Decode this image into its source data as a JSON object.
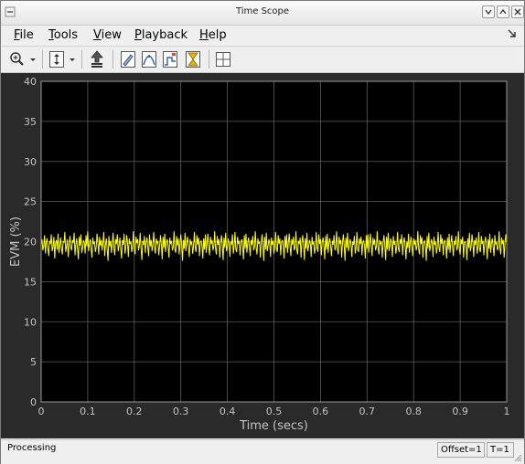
{
  "window": {
    "title": "Time Scope"
  },
  "menu": [
    {
      "label": "File",
      "mnemonic": "F",
      "rest": "ile"
    },
    {
      "label": "Tools",
      "mnemonic": "T",
      "rest": "ools"
    },
    {
      "label": "View",
      "mnemonic": "V",
      "rest": "iew"
    },
    {
      "label": "Playback",
      "mnemonic": "P",
      "rest": "layback"
    },
    {
      "label": "Help",
      "mnemonic": "H",
      "rest": "elp"
    }
  ],
  "toolbar": {
    "tools": [
      {
        "name": "zoom-in-icon"
      },
      {
        "name": "zoom-dropdown-icon"
      },
      {
        "name": "scale-axes-icon"
      },
      {
        "name": "scale-dropdown-icon"
      },
      {
        "name": "bring-forward-icon"
      },
      {
        "name": "style-icon"
      },
      {
        "name": "measure-peaks-icon"
      },
      {
        "name": "measure-stats-icon"
      },
      {
        "name": "triggers-icon"
      },
      {
        "name": "layout-icon"
      }
    ]
  },
  "colors": {
    "axes_bg": "#000000",
    "figure_bg": "#2a2a2a",
    "grid": "#5e5e5e",
    "tick_text": "#c4c4c4",
    "trace": "#ffff00"
  },
  "chart_data": {
    "type": "line",
    "title": "",
    "xlabel": "Time (secs)",
    "ylabel": "EVM (%)",
    "xlim": [
      0,
      1
    ],
    "ylim": [
      0,
      40
    ],
    "xticks": [
      0,
      0.1,
      0.2,
      0.3,
      0.4,
      0.5,
      0.6,
      0.7,
      0.8,
      0.9,
      1
    ],
    "yticks": [
      0,
      5,
      10,
      15,
      20,
      25,
      30,
      35,
      40
    ],
    "grid": true,
    "legend": "none",
    "series": [
      {
        "color": "#ffff00",
        "x_start": 0,
        "x_end": 1,
        "mean": 19.6,
        "min": 17.5,
        "max": 21.3,
        "samples": [
          19.6,
          20.3,
          18.9,
          19.4,
          20.8,
          18.5,
          19.9,
          20.4,
          19.1,
          18.2,
          20.1,
          19.7,
          20.9,
          18.8,
          19.3,
          20.6,
          17.9,
          19.8,
          20.2,
          19.0,
          21.0,
          18.6,
          19.5,
          20.5,
          19.2,
          18.4,
          20.0,
          19.9,
          21.2,
          18.7,
          19.4,
          20.3,
          18.1,
          19.6,
          20.7,
          19.3,
          18.9,
          20.2,
          19.8,
          21.1,
          18.3,
          19.7,
          20.4,
          19.0,
          17.8,
          20.6,
          19.5,
          20.9,
          18.6,
          19.2,
          20.1,
          19.9,
          18.5,
          20.8,
          19.4,
          21.3,
          18.8,
          19.6,
          20.3,
          19.1,
          18.0,
          20.5,
          19.7,
          20.0,
          18.7,
          19.3,
          21.0,
          19.8,
          18.4,
          20.6,
          19.5,
          20.2,
          18.9,
          19.9,
          21.2,
          18.2,
          19.6,
          20.4,
          19.0,
          17.6,
          20.7,
          19.4,
          20.1,
          18.6,
          19.8,
          21.1,
          19.2,
          18.3,
          20.3,
          19.7,
          20.9,
          18.8,
          19.5,
          20.5,
          19.1,
          17.9,
          20.2,
          19.6,
          21.0,
          18.5,
          19.3,
          20.8,
          19.9,
          18.1,
          20.4,
          19.7,
          20.0,
          18.7,
          19.4,
          21.3,
          19.0,
          18.4,
          20.6,
          19.8,
          20.3,
          18.9,
          19.5,
          21.1,
          19.2,
          17.7,
          20.1,
          19.6,
          20.7,
          18.6,
          19.9,
          20.5,
          19.3,
          18.2,
          20.9,
          19.4,
          20.2,
          18.8,
          19.7,
          21.2,
          19.1,
          18.5,
          20.4,
          19.8,
          20.0,
          18.3,
          19.5,
          20.8,
          19.6,
          17.8,
          20.6,
          19.2,
          21.0,
          18.7,
          19.9,
          20.3,
          19.4,
          18.0,
          20.5,
          19.7,
          20.1,
          18.9,
          19.3,
          21.3,
          19.0,
          18.6,
          20.7,
          19.5,
          20.4,
          18.4,
          19.8,
          20.9,
          19.6,
          17.6,
          20.2,
          19.1,
          21.1,
          18.8,
          19.9,
          20.6,
          19.3,
          18.1,
          20.3,
          19.7,
          20.0,
          18.5,
          19.4,
          21.2,
          19.2,
          18.7,
          20.8,
          19.6,
          20.5,
          18.2,
          19.9,
          20.1,
          19.5,
          17.9,
          20.4,
          19.0,
          20.9,
          18.6,
          19.8,
          21.0,
          19.3,
          18.3,
          20.6,
          19.7,
          20.2,
          18.9,
          19.4,
          21.3,
          19.1,
          18.4,
          20.7,
          19.6,
          20.3,
          18.0,
          19.9,
          20.8,
          19.5,
          17.7,
          20.5,
          19.2,
          21.1,
          18.8,
          19.3,
          20.4,
          19.8,
          18.1,
          20.0,
          19.6,
          20.9,
          18.5,
          19.4,
          21.2,
          19.0,
          18.7,
          20.6,
          19.7,
          20.1,
          18.3,
          19.9,
          20.3,
          19.5,
          17.8,
          20.8,
          19.1,
          21.0,
          18.6,
          19.8,
          20.5,
          19.4,
          18.2,
          20.2,
          19.6,
          20.7,
          18.9,
          19.3,
          21.3,
          19.2,
          18.4,
          20.4,
          19.7,
          20.0,
          18.0,
          19.9,
          20.9,
          19.5,
          17.6,
          20.6,
          19.0,
          21.1,
          18.8,
          19.4,
          20.3,
          19.8,
          18.1,
          20.5,
          19.6,
          20.1,
          18.5,
          19.3,
          21.2,
          19.1,
          18.7,
          20.8,
          19.7,
          20.4,
          18.3,
          19.9,
          20.2,
          19.5,
          17.9,
          20.7,
          19.2,
          20.9,
          18.6,
          19.8,
          21.0,
          19.4,
          18.2,
          20.3,
          19.6,
          20.6,
          18.9,
          19.3,
          21.3,
          19.0,
          18.4,
          20.1,
          19.7,
          20.5,
          18.0,
          19.9,
          20.8,
          19.5,
          17.7,
          20.4,
          19.1,
          21.1,
          18.8,
          19.4,
          20.2,
          19.8,
          18.1,
          20.6,
          19.6,
          20.0,
          18.5,
          19.3,
          21.2,
          19.2,
          18.7,
          20.9,
          19.7,
          20.3,
          18.3,
          19.9,
          20.5,
          19.5,
          17.8,
          20.7,
          19.0,
          21.0,
          18.6,
          19.8,
          20.4,
          19.4,
          18.2,
          20.1,
          19.6,
          20.8,
          18.9,
          19.3,
          21.3,
          19.1,
          18.4,
          20.6,
          19.7,
          20.2,
          18.0,
          19.9,
          20.9,
          19.5,
          17.6,
          20.5,
          19.2,
          21.1,
          18.8,
          19.4,
          20.3,
          19.8,
          18.1,
          20.0,
          19.6,
          20.7,
          18.5,
          19.3,
          21.2,
          19.0,
          18.7,
          20.4,
          19.7,
          20.6,
          18.3,
          19.9,
          20.1,
          19.5,
          17.9,
          20.8,
          19.1,
          20.9,
          18.6,
          19.8,
          21.0,
          19.4,
          18.2,
          20.5,
          19.6,
          20.3,
          18.9,
          19.3,
          21.3,
          19.2,
          18.4,
          20.2,
          19.7,
          20.0,
          18.0,
          19.9,
          20.8,
          19.5,
          17.7,
          20.6,
          19.0,
          21.1,
          18.8,
          19.4,
          20.4,
          19.8,
          18.1,
          20.7,
          19.6,
          20.1,
          18.5,
          19.3,
          21.2,
          19.1,
          18.7,
          20.3,
          19.7,
          20.9,
          18.3,
          19.9,
          20.5,
          19.5,
          17.8,
          20.0,
          19.2,
          21.0,
          18.6,
          19.8,
          20.6,
          19.4,
          18.2,
          20.4,
          19.6,
          20.2,
          18.9,
          19.3,
          21.3,
          19.0,
          18.4,
          20.8,
          19.7,
          20.5,
          18.0,
          19.9,
          20.1,
          19.5,
          17.6,
          20.7,
          19.1,
          21.1,
          18.8,
          19.4,
          20.3,
          19.8,
          18.1,
          20.6,
          19.6,
          20.0,
          18.5,
          19.3,
          21.2,
          19.2,
          18.7,
          20.9,
          19.7,
          20.4,
          18.3,
          19.9,
          20.2,
          19.5,
          17.9,
          20.5,
          19.0,
          21.0,
          18.6,
          19.8,
          20.8,
          19.4,
          18.2,
          20.1,
          19.6,
          20.7,
          18.9,
          19.3,
          21.3,
          19.1,
          18.4,
          20.3,
          19.7,
          20.6,
          18.0,
          19.9,
          20.0,
          19.5,
          17.7,
          20.4,
          19.2,
          21.1,
          18.8,
          19.4,
          20.9,
          19.8,
          18.1,
          20.2,
          19.6,
          20.5,
          18.5,
          19.3,
          21.2,
          19.0,
          18.7,
          20.7,
          19.7,
          20.1,
          18.3,
          19.9,
          20.6,
          19.5,
          17.8,
          20.3,
          19.1,
          21.0,
          18.6,
          19.8,
          20.4,
          19.4,
          18.2,
          20.8,
          19.6,
          20.0,
          18.9,
          19.3,
          21.3,
          19.2,
          18.4,
          20.5,
          19.7,
          20.2,
          18.0,
          19.9,
          20.9,
          19.6
        ]
      }
    ]
  },
  "status": {
    "text": "Processing",
    "offset": "Offset=1",
    "time": "T=1"
  }
}
